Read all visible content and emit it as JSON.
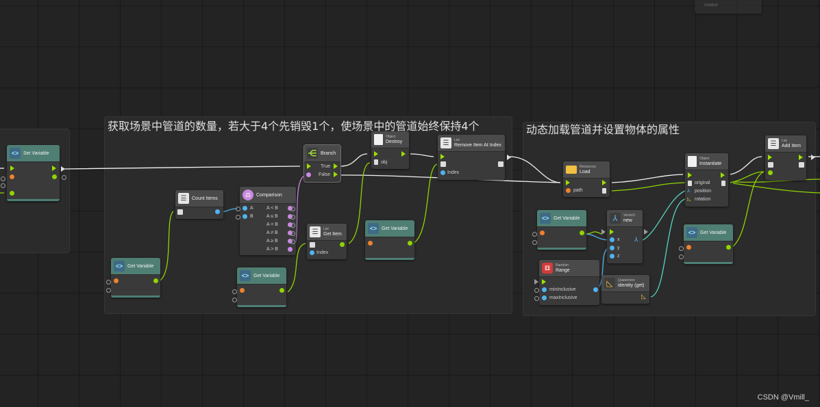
{
  "groups": {
    "left_title": "获取场景中管道的数量，若大于4个先销毁1个，使场景中的管道始终保持4个",
    "right_title": "动态加载管道并设置物体的属性"
  },
  "nodes": {
    "set_variable": {
      "title": "Set Variable"
    },
    "count_items": {
      "title": "Count Items"
    },
    "comparison": {
      "title": "Comparison",
      "in_a": "A",
      "in_b": "B",
      "outputs": [
        "A < B",
        "A ≤ B",
        "A = B",
        "A ≠ B",
        "A ≥ B",
        "A > B"
      ]
    },
    "branch": {
      "title": "Branch",
      "true_label": "True",
      "false_label": "False"
    },
    "destroy": {
      "category": "Object",
      "title": "Destroy",
      "obj_label": "obj"
    },
    "remove_item": {
      "category": "List",
      "title": "Remove Item At Index",
      "index_label": "Index"
    },
    "get_item": {
      "category": "List",
      "title": "Get Item",
      "index_label": "Index"
    },
    "get_variable_1": {
      "title": "Get Variable"
    },
    "get_variable_2": {
      "title": "Get Variable"
    },
    "get_variable_3": {
      "title": "Get Variable"
    },
    "get_variable_4": {
      "title": "Get Variable"
    },
    "get_variable_5": {
      "title": "Get Variable"
    },
    "resources_load": {
      "category": "Resources",
      "title": "Load",
      "path_label": "path"
    },
    "vector3_new": {
      "category": "Vector3",
      "title": "new",
      "x_label": "x",
      "y_label": "y",
      "z_label": "z"
    },
    "random_range": {
      "category": "Random",
      "title": "Range",
      "min_label": "minInclusive",
      "max_label": "maxInclusive"
    },
    "quaternion_identity": {
      "category": "Quaternion",
      "title": "identity (get)"
    },
    "instantiate": {
      "category": "Object",
      "title": "Instantiate",
      "original_label": "original",
      "position_label": "position",
      "rotation_label": "rotation"
    },
    "add_item": {
      "category": "List",
      "title": "Add Item"
    },
    "top_partial": {
      "rotation_label": "rotation"
    }
  },
  "watermark": "CSDN @Vmill_",
  "colors": {
    "flow": "#9be100",
    "exec_wire": "#f0f0f0",
    "object_port": "#f0812d",
    "number_port": "#50b4f0",
    "bool_port": "#cc88e6",
    "variable_header": "#4f7e73"
  },
  "icons": {
    "variable": "variable-icon",
    "list": "list-icon",
    "object": "document-icon",
    "branch": "branch-icon",
    "comparison": "scale-icon",
    "resources": "folder-icon",
    "vector3": "axes-icon",
    "random": "dice-icon",
    "quaternion": "ruler-triangle-icon"
  }
}
